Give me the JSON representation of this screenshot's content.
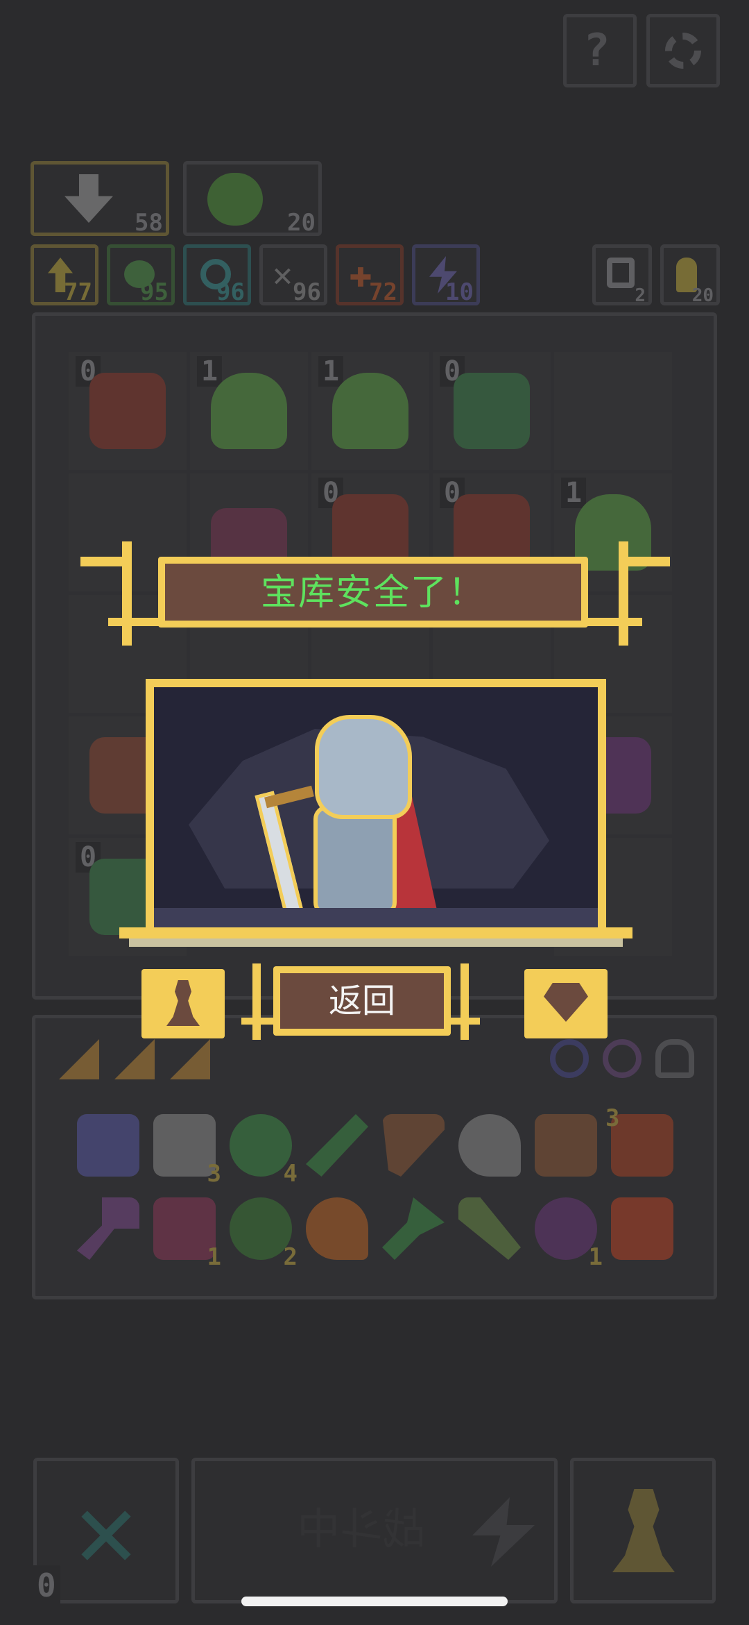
{
  "top_buttons": {
    "help_icon": "question-icon",
    "settings_icon": "gear-icon"
  },
  "resources": {
    "attack_power": "58",
    "slime_count": "20"
  },
  "stats": [
    {
      "icon": "arrow-up-icon",
      "value": "77",
      "color": "#b6a23f"
    },
    {
      "icon": "green-orb-icon",
      "value": "95",
      "color": "#4f8e4a"
    },
    {
      "icon": "spiral-icon",
      "value": "96",
      "color": "#3b8c8c"
    },
    {
      "icon": "crossed-swords-icon",
      "value": "96",
      "color": "#8d8d8d"
    },
    {
      "icon": "fire-cross-icon",
      "value": "72",
      "color": "#b4572e"
    },
    {
      "icon": "lightning-icon",
      "value": "10",
      "color": "#6a63a6"
    }
  ],
  "side_stats": [
    {
      "icon": "loop-icon",
      "value": "2"
    },
    {
      "icon": "key-icon",
      "value": "20"
    }
  ],
  "grid": [
    {
      "level": "0",
      "kind": "red-dragon",
      "color": "#8a3d32"
    },
    {
      "level": "1",
      "kind": "green-slime",
      "color": "#5c9a48"
    },
    {
      "level": "1",
      "kind": "green-slime",
      "color": "#5c9a48"
    },
    {
      "level": "0",
      "kind": "green-totem",
      "color": "#3f7d4c"
    },
    {
      "level": "",
      "kind": "empty",
      "color": ""
    },
    {
      "level": "",
      "kind": "empty",
      "color": ""
    },
    {
      "level": "",
      "kind": "crystal-plant",
      "color": "#7a3a55"
    },
    {
      "level": "0",
      "kind": "red-dragon",
      "color": "#8a3d32"
    },
    {
      "level": "0",
      "kind": "red-dragon",
      "color": "#8a3d32"
    },
    {
      "level": "1",
      "kind": "green-slime",
      "color": "#5c9a48"
    },
    {
      "level": "",
      "kind": "crystal-plant",
      "color": "#8a4a38"
    },
    {
      "level": "",
      "kind": "",
      "color": ""
    },
    {
      "level": "",
      "kind": "",
      "color": ""
    },
    {
      "level": "",
      "kind": "",
      "color": ""
    },
    {
      "level": "",
      "kind": "purple-demon",
      "color": "#6e3a78"
    },
    {
      "level": "0",
      "kind": "green-totem",
      "color": "#3f7d4c"
    },
    {
      "level": "",
      "kind": "",
      "color": ""
    },
    {
      "level": "",
      "kind": "",
      "color": ""
    },
    {
      "level": "",
      "kind": "",
      "color": ""
    },
    {
      "level": "",
      "kind": "",
      "color": ""
    }
  ],
  "popup": {
    "title": "宝库安全了！",
    "title_color": "#5ee25e",
    "scene": "armored-knight-with-sword",
    "back_label": "返回",
    "left_icon": "pawn-icon",
    "right_icon": "gem-icon"
  },
  "inventory": {
    "card_icons": [
      "card-icon",
      "card-icon",
      "card-icon"
    ],
    "ring_icons": [
      "ring-icon",
      "ring-icon",
      "helmet-icon"
    ],
    "row1": [
      {
        "icon": "mask-icon",
        "count": "",
        "color": "#5a5aa0"
      },
      {
        "icon": "scroll-icon",
        "count": "3",
        "color": "#8a8a8a"
      },
      {
        "icon": "green-gem-icon",
        "count": "4",
        "color": "#3f8a4a"
      },
      {
        "icon": "green-sword-icon",
        "count": "",
        "color": "#3f8a4a"
      },
      {
        "icon": "slingshot-icon",
        "count": "",
        "color": "#8a5a3a"
      },
      {
        "icon": "bone-hook-icon",
        "count": "",
        "color": "#8a8a8a"
      },
      {
        "icon": "treasure-basket-icon",
        "count": "",
        "color": "#8a5a3a"
      },
      {
        "icon": "lightning-card-icon",
        "count": "3",
        "color": "#a4462a"
      }
    ],
    "row2": [
      {
        "icon": "purple-axe-icon",
        "count": "",
        "color": "#7a4a88"
      },
      {
        "icon": "potion-icon",
        "count": "1",
        "color": "#8a3a5a"
      },
      {
        "icon": "green-sprout-icon",
        "count": "2",
        "color": "#3f7a3a"
      },
      {
        "icon": "orange-hook-icon",
        "count": "",
        "color": "#b5652a"
      },
      {
        "icon": "green-axe-icon",
        "count": "",
        "color": "#3f8a4a"
      },
      {
        "icon": "arrow-icon",
        "count": "",
        "color": "#6a8a4a"
      },
      {
        "icon": "monster-face-icon",
        "count": "1",
        "color": "#6a3a78"
      },
      {
        "icon": "fire-card-icon",
        "count": "",
        "color": "#b5452a"
      }
    ]
  },
  "bottom_bar": {
    "cancel_icon": "cross-icon",
    "cancel_count": "0",
    "battle_label": "战斗中",
    "battle_icon": "lightning-icon",
    "pawn_icon": "pawn-icon"
  }
}
